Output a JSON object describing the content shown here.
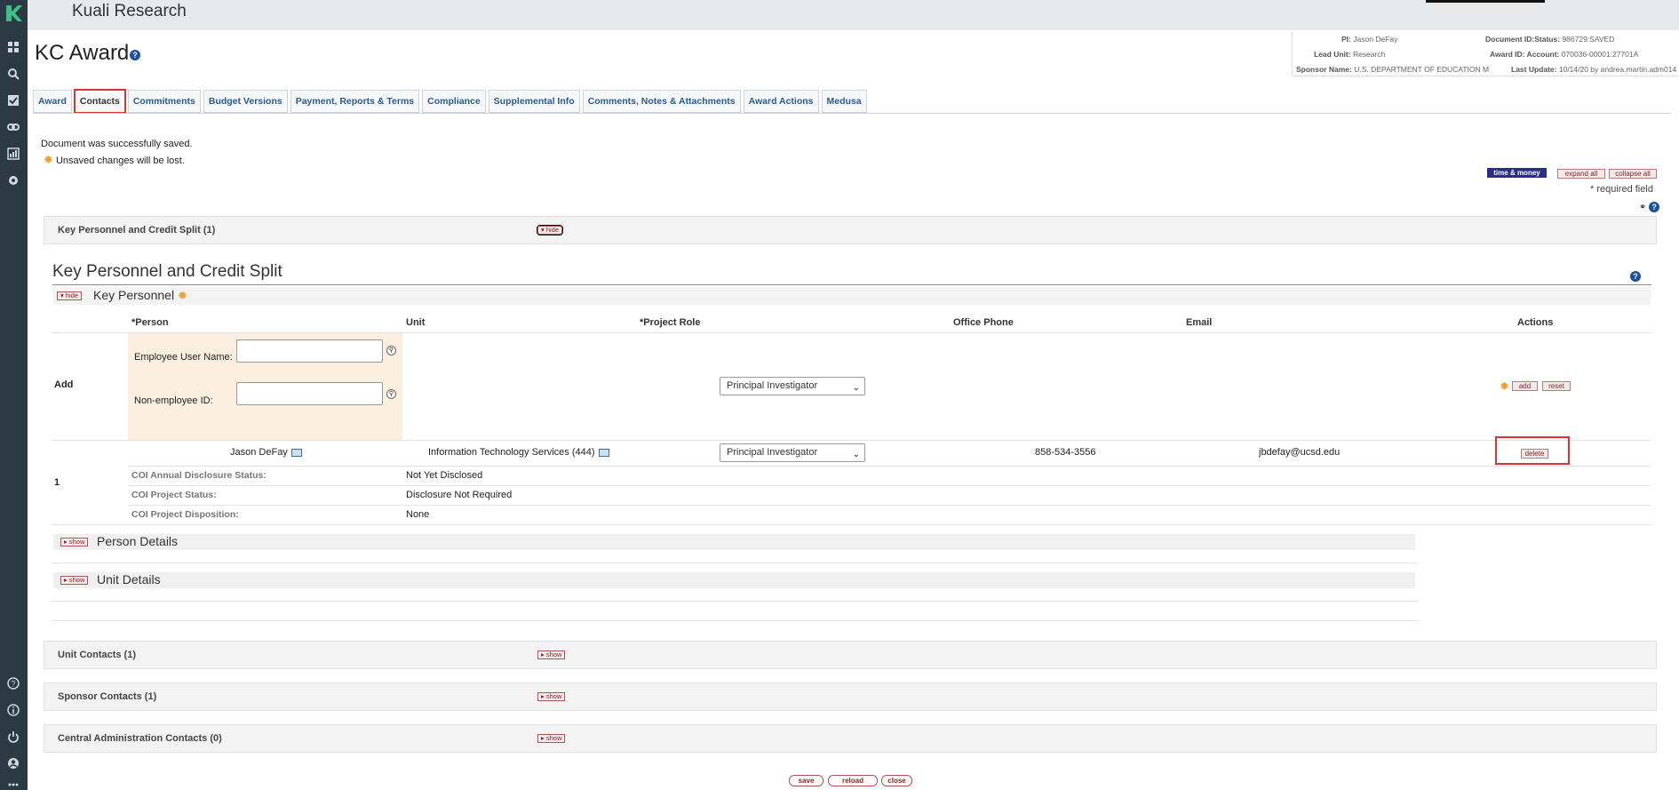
{
  "app": {
    "brand": "Kuali Research",
    "page_title": "KC Award"
  },
  "doc_info": {
    "pi_label": "PI:",
    "pi_value": "Jason DeFay",
    "doc_label": "Document ID:Status:",
    "doc_value": "986729:SAVED",
    "lead_unit_label": "Lead Unit:",
    "lead_unit_value": "Research",
    "award_label": "Award ID: Account:",
    "award_value": "070036-00001:27701A",
    "sponsor_label": "Sponsor Name:",
    "sponsor_value": "U.S. DEPARTMENT OF EDUCATION M",
    "last_update_label": "Last Update:",
    "last_update_value": "10/14/20 by andrea.martin.adm014"
  },
  "tabs": [
    "Award",
    "Contacts",
    "Commitments",
    "Budget Versions",
    "Payment, Reports & Terms",
    "Compliance",
    "Supplemental Info",
    "Comments, Notes & Attachments",
    "Award Actions",
    "Medusa"
  ],
  "messages": {
    "saved": "Document was successfully saved.",
    "unsaved": "Unsaved changes will be lost."
  },
  "toolbar": {
    "time_money": "time & money",
    "expand_all": "expand all",
    "collapse_all": "collapse all",
    "required": "* required field"
  },
  "sections": {
    "key_personnel_bar": "Key Personnel and Credit Split (1)",
    "hide": "hide",
    "show": "show",
    "kp_title": "Key Personnel and Credit Split",
    "kp_sub": "Key Personnel",
    "unit_contacts": "Unit Contacts (1)",
    "sponsor_contacts": "Sponsor Contacts (1)",
    "central_admin": "Central Administration Contacts (0)",
    "person_details": "Person Details",
    "unit_details": "Unit Details"
  },
  "table": {
    "headers": [
      "*Person",
      "Unit",
      "*Project Role",
      "Office Phone",
      "Email",
      "Actions"
    ],
    "add_row": {
      "label": "Add",
      "employee_label": "Employee User Name:",
      "nonemployee_label": "Non-employee ID:",
      "role": "Principal Investigator",
      "add_btn": "add",
      "reset_btn": "reset"
    },
    "person_row": {
      "index": "1",
      "person": "Jason DeFay",
      "unit": "Information Technology Services (444)",
      "role": "Principal Investigator",
      "phone": "858-534-3556",
      "email": "jbdefay@ucsd.edu",
      "delete_btn": "delete"
    },
    "coi": [
      {
        "label": "COI Annual Disclosure Status:",
        "value": "Not Yet Disclosed"
      },
      {
        "label": "COI Project Status:",
        "value": "Disclosure Not Required"
      },
      {
        "label": "COI Project Disposition:",
        "value": "None"
      }
    ]
  },
  "footer": {
    "save": "save",
    "reload": "reload",
    "close": "close"
  },
  "colors": {
    "rail": "#2b3a42",
    "accent_link": "#2a5b8c",
    "highlight": "#dd3333",
    "add_bg": "#fdefdf"
  }
}
